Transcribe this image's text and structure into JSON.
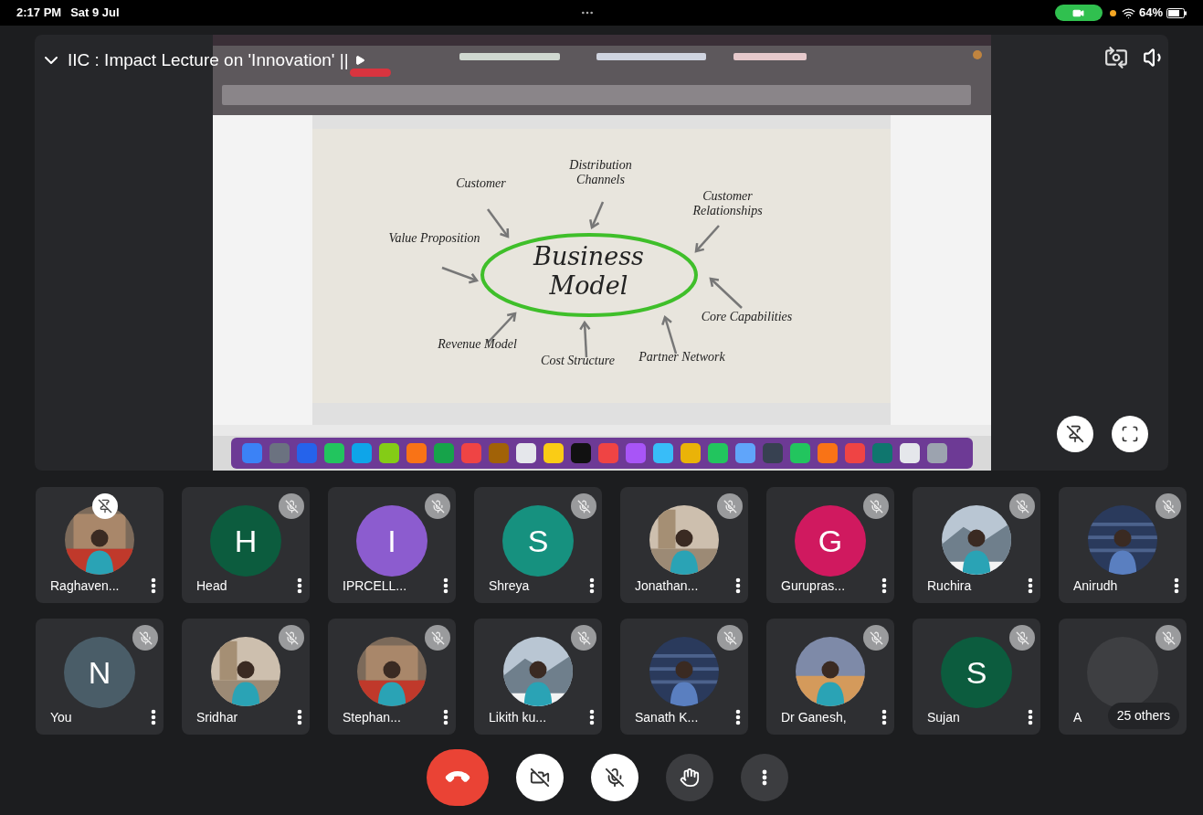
{
  "status_bar": {
    "time": "2:17 PM",
    "date": "Sat 9 Jul",
    "battery": "64%"
  },
  "meeting": {
    "title": "IIC : Impact Lecture on 'Innovation' ||"
  },
  "slide": {
    "center": "Business Model",
    "labels": [
      "Distribution Channels",
      "Customer",
      "Customer Relationships",
      "Value Proposition",
      "Core Capabilities",
      "Revenue Model",
      "Cost Structure",
      "Partner Network"
    ]
  },
  "participants": [
    {
      "name": "Raghaven...",
      "badge": {
        "kind": "pin"
      }
    },
    {
      "name": "Head",
      "avatar": {
        "kind": "letter",
        "letter": "H",
        "color": "#0c5c3e"
      },
      "badge": {
        "kind": "muted"
      }
    },
    {
      "name": "IPRCELL...",
      "avatar": {
        "kind": "letter",
        "letter": "I",
        "color": "#8c5ccf"
      },
      "badge": {
        "kind": "muted"
      }
    },
    {
      "name": "Shreya",
      "avatar": {
        "kind": "letter",
        "letter": "S",
        "color": "#16917f"
      },
      "badge": {
        "kind": "muted"
      }
    },
    {
      "name": "Jonathan...",
      "badge": {
        "kind": "muted"
      }
    },
    {
      "name": "Gurupras...",
      "avatar": {
        "kind": "letter",
        "letter": "G",
        "color": "#d0195f"
      },
      "badge": {
        "kind": "muted"
      }
    },
    {
      "name": "Ruchira",
      "badge": {
        "kind": "muted"
      }
    },
    {
      "name": "Anirudh",
      "badge": {
        "kind": "muted"
      }
    },
    {
      "name": "You",
      "avatar": {
        "kind": "letter",
        "letter": "N",
        "color": "#4a5d68"
      },
      "badge": {
        "kind": "muted"
      }
    },
    {
      "name": "Sridhar",
      "badge": {
        "kind": "muted"
      }
    },
    {
      "name": "Stephan...",
      "badge": {
        "kind": "muted"
      }
    },
    {
      "name": "Likith ku...",
      "badge": {
        "kind": "muted"
      }
    },
    {
      "name": "Sanath K...",
      "badge": {
        "kind": "muted"
      }
    },
    {
      "name": "Dr Ganesh,",
      "badge": {
        "kind": "muted"
      }
    },
    {
      "name": "Sujan",
      "avatar": {
        "kind": "letter",
        "letter": "S",
        "color": "#0c5c3e"
      },
      "badge": {
        "kind": "muted"
      }
    },
    {
      "name": "A",
      "avatar": {
        "kind": "blank"
      },
      "badge": {
        "kind": "muted"
      },
      "others": "25 others"
    }
  ],
  "controls": [
    {
      "kind": "end"
    },
    {
      "kind": "camera"
    },
    {
      "kind": "mic"
    },
    {
      "kind": "hand"
    },
    {
      "kind": "more"
    }
  ]
}
